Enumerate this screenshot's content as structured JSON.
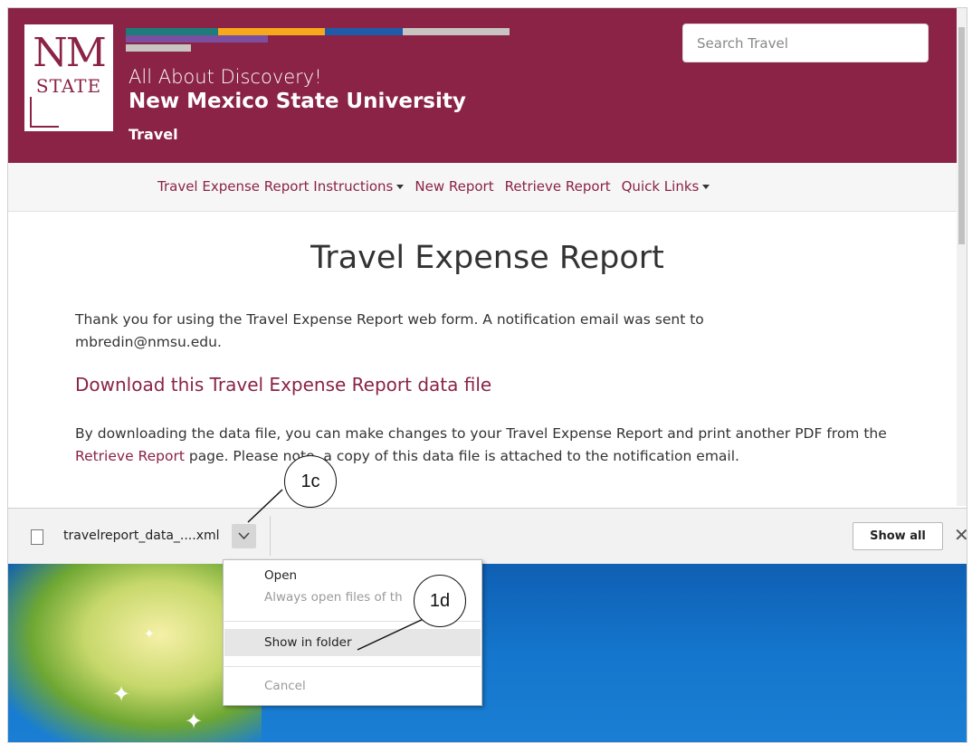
{
  "header": {
    "logo_nm": "NM",
    "logo_state": "STATE",
    "tagline": "All About Discovery!",
    "university": "New Mexico State University",
    "department": "Travel",
    "search_placeholder": "Search Travel",
    "accent_colors": [
      "#1c7c7a",
      "#f7a81b",
      "#1f5ba8",
      "#c8c4c2",
      "#7b4ea0"
    ],
    "brand_color": "#8a2346"
  },
  "nav": {
    "items": [
      {
        "label": "Travel Expense Report Instructions",
        "dropdown": true
      },
      {
        "label": "New Report",
        "dropdown": false
      },
      {
        "label": "Retrieve Report",
        "dropdown": false
      },
      {
        "label": "Quick Links",
        "dropdown": true
      }
    ]
  },
  "content": {
    "title": "Travel Expense Report",
    "thanks_text": "Thank you for using the Travel Expense Report web form. A notification email was sent to",
    "email": "mbredin@nmsu.edu",
    "email_suffix": ".",
    "download_heading": "Download this Travel Expense Report data file",
    "desc_part1": "By downloading the data file, you can make changes to your Travel Expense Report and print another PDF from the ",
    "desc_link": "Retrieve Report",
    "desc_part2": " page. Please note, a copy of this data file is attached to the notification email."
  },
  "download_bar": {
    "filename": "travelreport_data_....xml",
    "show_all_label": "Show all",
    "close_icon": "close-icon"
  },
  "context_menu": {
    "items": [
      {
        "label": "Open",
        "disabled": false
      },
      {
        "label": "Always open files of th",
        "disabled": true
      },
      {
        "label": "Show in folder",
        "disabled": false,
        "highlighted": true
      },
      {
        "label": "Cancel",
        "disabled": true
      }
    ]
  },
  "callouts": {
    "c1": "1c",
    "c2": "1d"
  }
}
